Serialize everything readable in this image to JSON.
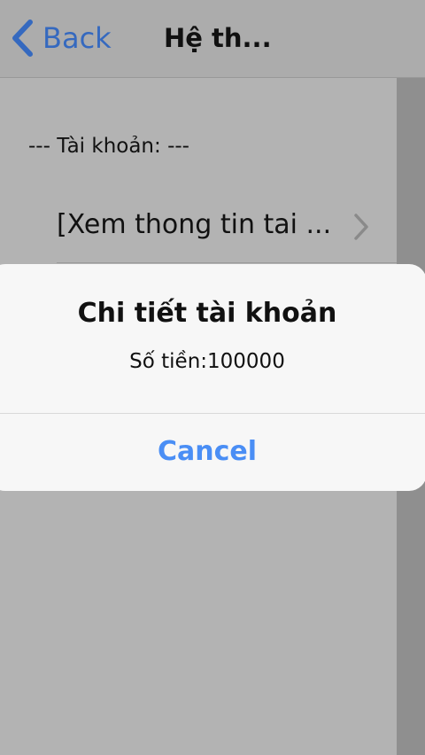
{
  "navbar": {
    "back_label": "Back",
    "back_icon": "chevron-left-icon",
    "title": "Hệ th..."
  },
  "content": {
    "section_header": "--- Tài khoản: ---",
    "items": [
      {
        "label": "[Xem thong tin tai ...",
        "icon": "chevron-right-icon"
      }
    ]
  },
  "alert": {
    "title": "Chi tiết tài khoản",
    "message": "Số tiền:100000",
    "cancel_label": "Cancel"
  },
  "colors": {
    "accent_back": "#3569bf",
    "accent_cancel": "#4a8ef5",
    "background": "#b3b3b3",
    "dialog": "#f7f7f7"
  }
}
